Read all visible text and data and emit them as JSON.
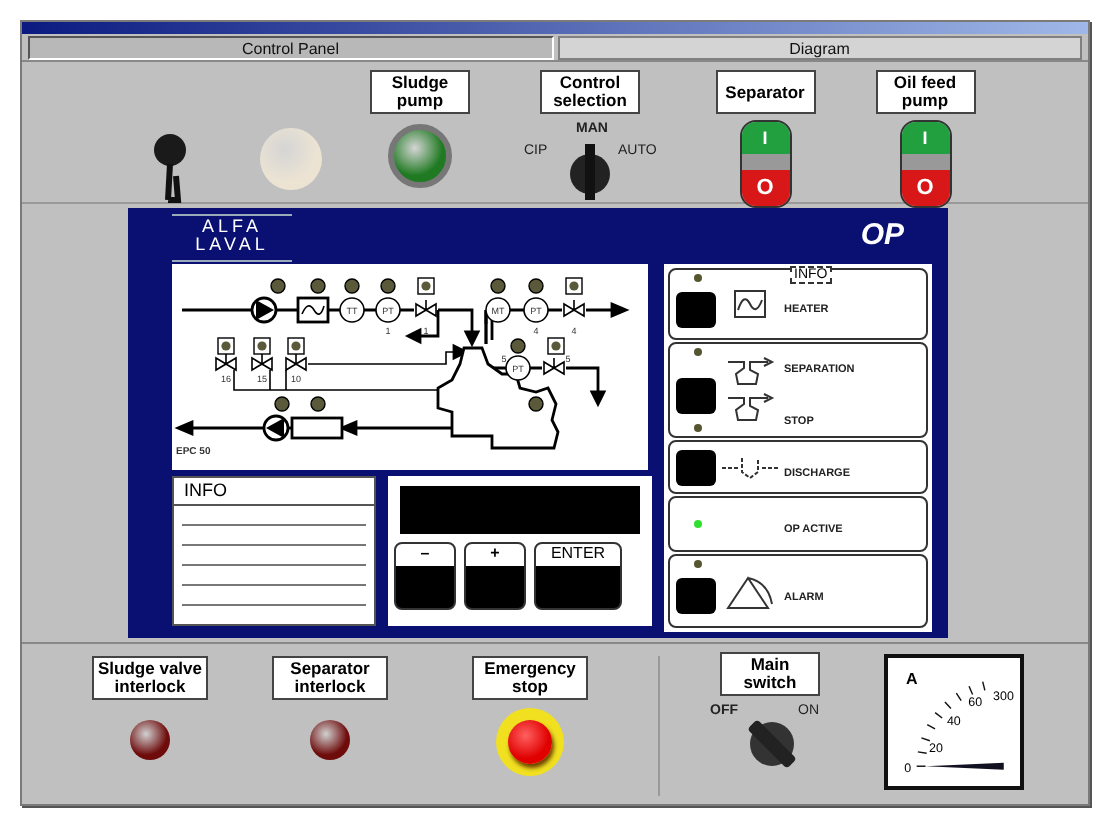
{
  "tabs": [
    {
      "label": "Control Panel",
      "selected": true
    },
    {
      "label": "Diagram",
      "selected": false
    }
  ],
  "top_panel": [
    {
      "kind": "horn"
    },
    {
      "kind": "lamp",
      "color": "#ece3d3"
    },
    {
      "kind": "lamp",
      "label": "Sludge pump",
      "color": "#1f7a22"
    },
    {
      "kind": "selector",
      "label": "Control selection",
      "positions": [
        {
          "label": "CIP",
          "selected": false
        },
        {
          "label": "MAN",
          "selected": true
        },
        {
          "label": "AUTO",
          "selected": false
        }
      ]
    },
    {
      "kind": "pushbutton",
      "label": "Separator",
      "start": "I",
      "stop": "O"
    },
    {
      "kind": "pushbutton",
      "label": "Oil feed pump",
      "start": "I",
      "stop": "O"
    }
  ],
  "operator_panel": {
    "logo": {
      "top": "ALFA",
      "bottom": "LAVAL"
    },
    "title": "OP",
    "diagram": {
      "labels": [
        "TT",
        "PT",
        "1",
        "1",
        "MT",
        "PT",
        "4",
        "4",
        "16",
        "15",
        "10",
        "5",
        "PT",
        "5",
        "EPC 50"
      ]
    },
    "info": {
      "title": "INFO"
    },
    "keys": [
      "–",
      "+",
      "ENTER"
    ],
    "cursor_label": "INFO",
    "functions": [
      {
        "kind": "heater",
        "items": [
          {
            "label": "HEATER",
            "led": false
          }
        ]
      },
      {
        "kind": "separation",
        "items": [
          {
            "label": "SEPARATION",
            "led": false
          },
          {
            "label": "STOP",
            "led": false
          }
        ]
      },
      {
        "kind": "discharge",
        "items": [
          {
            "label": "DISCHARGE"
          }
        ]
      },
      {
        "kind": "status",
        "items": [
          {
            "label": "OP ACTIVE",
            "led": true
          }
        ]
      },
      {
        "kind": "alarm",
        "items": [
          {
            "label": "ALARM",
            "led": false
          }
        ]
      }
    ]
  },
  "bottom_panel": [
    {
      "kind": "lamp",
      "label": "Sludge valve interlock",
      "color": "#6e0b0b"
    },
    {
      "kind": "lamp",
      "label": "Separator interlock",
      "color": "#6e0b0b"
    },
    {
      "kind": "emergency_stop",
      "label": "Emergency stop"
    }
  ],
  "main_switch": {
    "label": "Main switch",
    "positions": [
      {
        "label": "OFF",
        "selected": true
      },
      {
        "label": "ON",
        "selected": false
      }
    ]
  },
  "ammeter": {
    "unit": "A",
    "scale": [
      "0",
      "20",
      "40",
      "60",
      "300"
    ]
  }
}
